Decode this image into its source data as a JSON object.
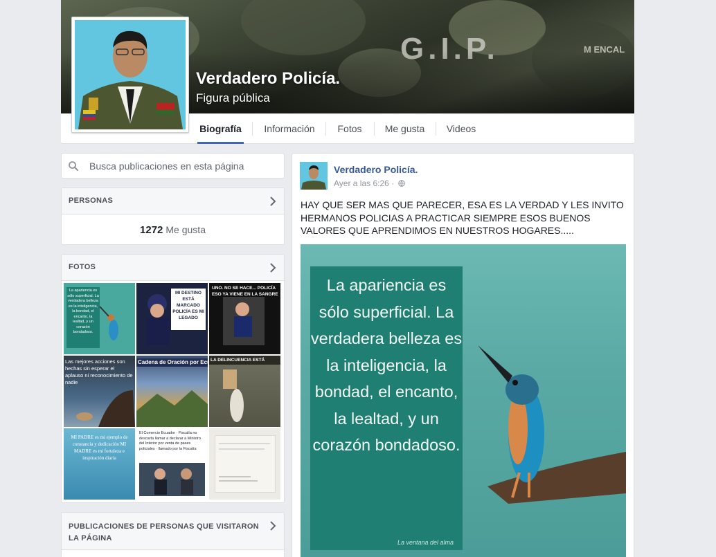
{
  "page": {
    "name": "Verdadero Policía.",
    "category": "Figura pública"
  },
  "cover": {
    "text_gip": "G.I.P.",
    "text_badge": "M ENCAL"
  },
  "tabs": [
    {
      "label": "Biografía",
      "active": true
    },
    {
      "label": "Información",
      "active": false
    },
    {
      "label": "Fotos",
      "active": false
    },
    {
      "label": "Me gusta",
      "active": false
    },
    {
      "label": "Videos",
      "active": false
    }
  ],
  "search": {
    "placeholder": "Busca publicaciones en esta página",
    "icon": "search-icon"
  },
  "people": {
    "title": "PERSONAS",
    "likes_count": "1272",
    "likes_label": "Me gusta"
  },
  "photos": {
    "title": "FOTOS",
    "thumbs": [
      {
        "caption": "La apariencia es sólo superficial. La verdadera belleza es la inteligencia, la bondad, el encanto, la lealtad, y un corazón bondadoso."
      },
      {
        "caption": "MI DESTINO ESTÁ MARCADO POLICÍA ES MI LEGADO"
      },
      {
        "caption": "UNO. NO SE HACE... POLICÍA ESO YA VIENE EN LA SANGRE"
      },
      {
        "caption": "Las mejores acciones son hechas sin esperar el aplauso ni reconocimiento de nadie"
      },
      {
        "caption": "Cadena de Oración por Ecuador"
      },
      {
        "caption": "LA DELINCUENCIA ESTÁ"
      },
      {
        "caption": "MI PADRE es mi ejemplo de constancia y dedicación MI MADRE es mi fortaleza e inspiración diaria"
      },
      {
        "caption": "El Comercio Ecuador · Fiscalía no descarta llamar a declarar a Ministro del Interior por venta de pases policiales · llamado por la Fiscalía"
      },
      {
        "caption": ""
      }
    ]
  },
  "visitors": {
    "title": "PUBLICACIONES DE PERSONAS QUE VISITARON LA PÁGINA"
  },
  "post": {
    "author": "Verdadero Policía.",
    "time": "Ayer a las 6:26 ·",
    "privacy_icon": "globe-icon",
    "text": "HAY QUE SER MAS QUE PARECER, ESA ES LA VERDAD Y LES INVITO HERMANOS POLICIAS A PRACTICAR SIEMPRE ESOS BUENOS VALORES QUE APRENDIMOS EN NUESTROS HOGARES.....",
    "image_quote": "La apariencia es sólo superficial. La verdadera belleza es la inteligencia, la bondad, el encanto, la lealtad, y un corazón bondadoso.",
    "image_watermark": "La ventana del alma"
  },
  "colors": {
    "accent": "#4267b2",
    "link": "#365899",
    "background": "#e9ebee"
  }
}
